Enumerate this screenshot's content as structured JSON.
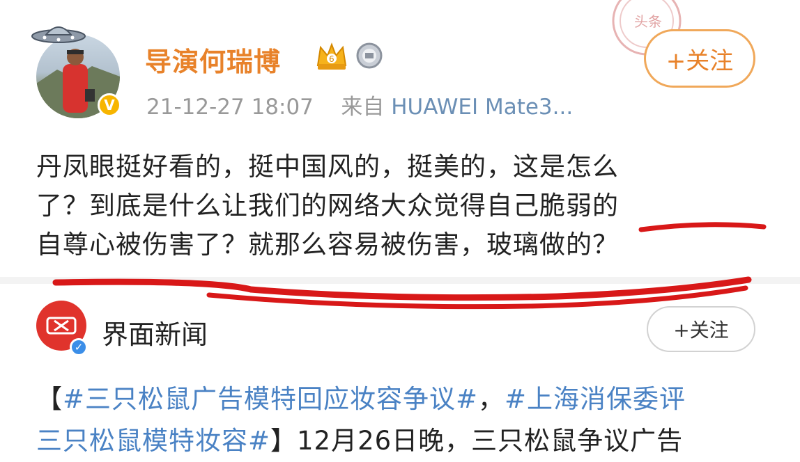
{
  "post": {
    "username": "导演何瑞博",
    "level_badge": "6",
    "verified_mark": "V",
    "timestamp": "21-12-27 18:07",
    "source_prefix": "来自",
    "device": "HUAWEI Mate3...",
    "follow_label": "+关注",
    "text_line1": "丹凤眼挺好看的，挺中国风的，挺美的，这是怎么",
    "text_line2": "了？到底是什么让我们的网络大众觉得自己脆弱的",
    "text_line3": "自尊心被伤害了？就那么容易被伤害，玻璃做的？",
    "icons": [
      "avatar",
      "ufo-icon",
      "crown-icon",
      "medal-icon",
      "verified-icon",
      "stamp-icon"
    ]
  },
  "repost": {
    "name": "界面新闻",
    "follow_label": "+关注",
    "bracket_open": "【",
    "hashtag1": "#三只松鼠广告模特回应妆容争议#",
    "comma": "，",
    "hashtag2_part1": "#上海消保委评",
    "hashtag2_part2": "三只松鼠模特妆容#",
    "rest": "】12月26日晚，三只松鼠争议广告"
  },
  "colors": {
    "username": "#e8822a",
    "link": "#4a82c4",
    "annotation": "#d81818"
  }
}
